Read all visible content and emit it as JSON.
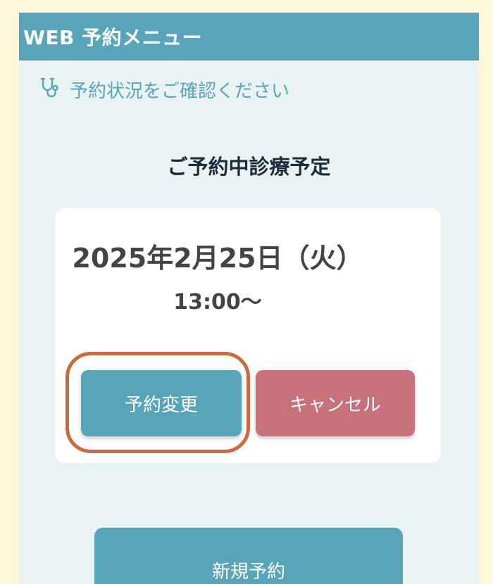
{
  "header": {
    "title": "WEB 予約メニュー"
  },
  "status": {
    "icon": "stethoscope-icon",
    "text": "予約状況をご確認ください"
  },
  "reservation": {
    "section_title": "ご予約中診療予定",
    "date": "2025年2月25日（火）",
    "time": "13:00〜",
    "change_label": "予約変更",
    "cancel_label": "キャンセル"
  },
  "new_reservation": {
    "label": "新規予約"
  },
  "colors": {
    "page_background": "#fdf7dc",
    "accent": "#58a5ba",
    "panel": "#eaf3f3",
    "cancel": "#c7727b",
    "highlight": "#cc6a3b"
  }
}
